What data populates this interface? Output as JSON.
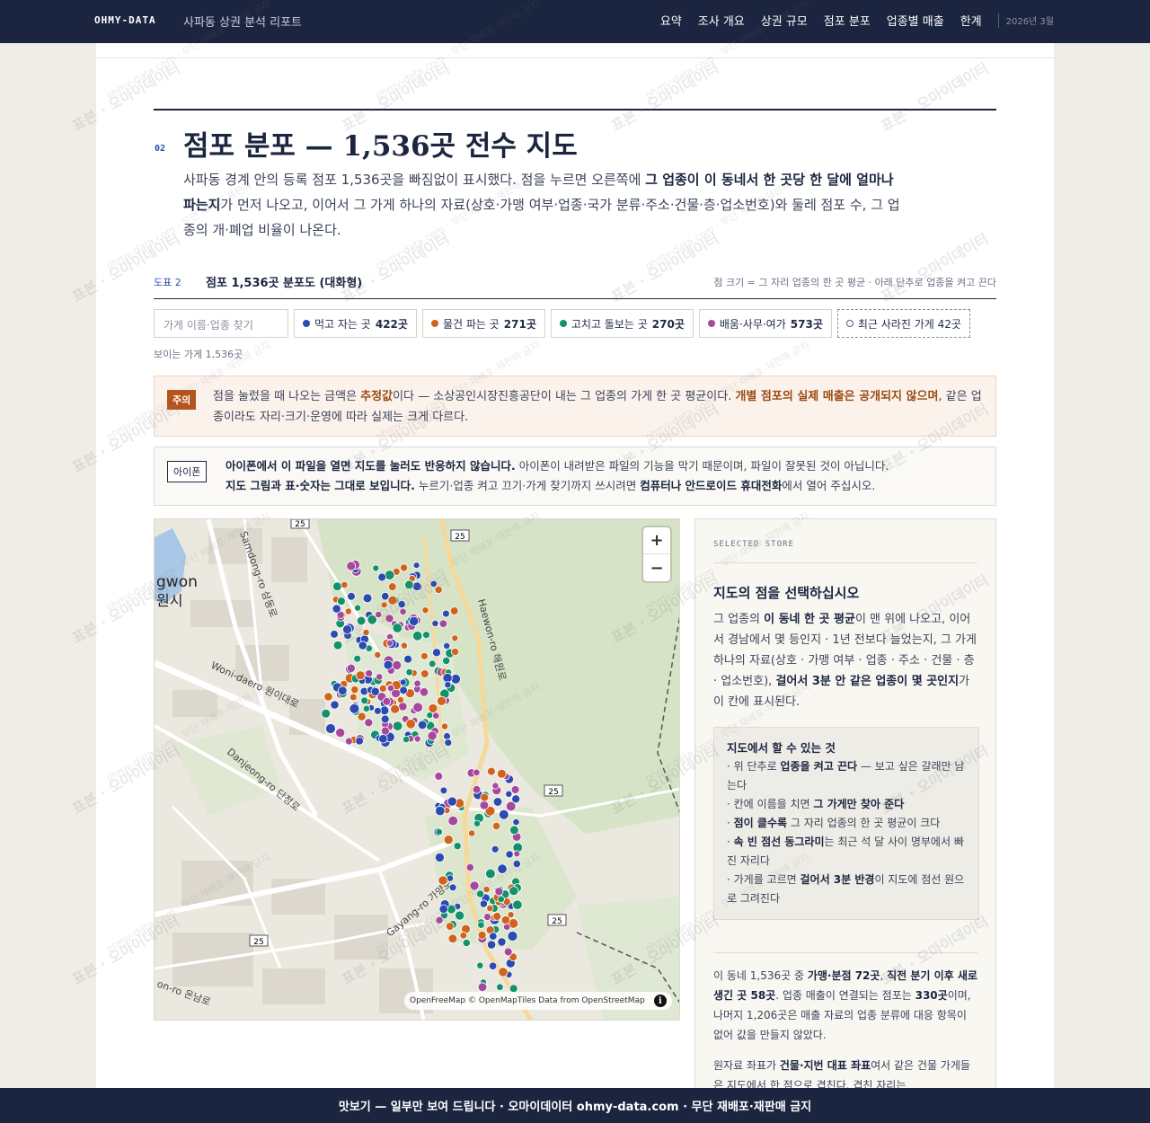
{
  "header": {
    "brand": "OHMY-DATA",
    "doc_title": "사파동 상권 분석 리포트",
    "nav": [
      "요약",
      "조사 개요",
      "상권 규모",
      "점포 분포",
      "업종별 매출",
      "한계"
    ],
    "date": "2026년 3월"
  },
  "section": {
    "number": "02",
    "title": "점포 분포 — 1,536곳 전수 지도",
    "lead_1": "사파동 경계 안의 등록 점포 1,536곳을 빠짐없이 표시했다. 점을 누르면 오른쪽에 ",
    "lead_bold": "그 업종이 이 동네서 한 곳당 한 달에 얼마나 파는지",
    "lead_2": "가 먼저 나오고, 이어서 그 가게 하나의 자료(상호·가맹 여부·업종·국가 분류·주소·건물·층·업소번호)와 둘레 점포 수, 그 업종의 개·폐업 비율이 나온다."
  },
  "figure": {
    "label": "도표 2",
    "title": "점포 1,536곳 분포도 (대화형)",
    "note": "점 크기 = 그 자리 업종의 한 곳 평균 · 아래 단추로 업종을 켜고 끈다"
  },
  "filters": {
    "search_placeholder": "가게 이름·업종 찾기",
    "chips": [
      {
        "label": "먹고 자는 곳",
        "count": "422곳",
        "color": "#2b4bb0"
      },
      {
        "label": "물건 파는 곳",
        "count": "271곳",
        "color": "#d0641c"
      },
      {
        "label": "고치고 돌보는 곳",
        "count": "270곳",
        "color": "#12916b"
      },
      {
        "label": "배움·사무·여가",
        "count": "573곳",
        "color": "#a6489c"
      }
    ],
    "closed_chip": "최근 사라진 가게 42곳",
    "visible_count": "보이는 가게 1,536곳"
  },
  "warning": {
    "tag": "주의",
    "t1": "점을 눌렀을 때 나오는 금액은 ",
    "b1": "추정값",
    "t2": "이다 — 소상공인시장진흥공단이 내는 그 업종의 가게 한 곳 평균이다. ",
    "b2": "개별 점포의 실제 매출은 공개되지 않으며",
    "t3": ", 같은 업종이라도 자리·크기·운영에 따라 실제는 크게 다르다."
  },
  "iphone": {
    "tag": "아이폰",
    "b1": "아이폰에서 이 파일을 열면 지도를 눌러도 반응하지 않습니다.",
    "t1": " 아이폰이 내려받은 파일의 기능을 막기 때문이며, 파일이 잘못된 것이 아닙니다.",
    "b2": "지도 그림과 표·숫자는 그대로 보입니다.",
    "t2": " 누르기·업종 켜고 끄기·가게 찾기까지 쓰시려면 ",
    "b3": "컴퓨터나 안드로이드 휴대전화",
    "t3": "에서 열어 주십시오."
  },
  "map": {
    "labels": {
      "city_en": "gwon",
      "city_ko": "원시",
      "road_haewon": "Haewon-ro 해원로",
      "road_wonidaero": "Woni-daero 원이대로",
      "road_danjeong": "Danjeong-ro 단정로",
      "road_gayang": "Gayang-ro 가양로",
      "road_sam": "Samdong-ro 삼동로",
      "road_on": "on-ro 온남로",
      "shield": "25"
    },
    "zoom_in": "+",
    "zoom_out": "−",
    "attribution": "OpenFreeMap © OpenMapTiles Data from OpenStreetMap",
    "info": "i"
  },
  "panel": {
    "kicker": "SELECTED STORE",
    "title": "지도의 점을 선택하십시오",
    "b1_a": "그 업종의 ",
    "b1_b": "이 동네 한 곳 평균",
    "b1_c": "이 맨 위에 나오고, 이어서 경남에서 몇 등인지 · 1년 전보다 늘었는지, 그 가게 하나의 자료(상호 · 가맹 여부 · 업종 · 주소 · 건물 · 층 · 업소번호), ",
    "b1_d": "걸어서 3분 안 같은 업종이 몇 곳인지",
    "b1_e": "가 이 칸에 표시된다.",
    "how_title": "지도에서 할 수 있는 것",
    "how_1a": "· 위 단추로 ",
    "how_1b": "업종을 켜고 끈다",
    "how_1c": " — 보고 싶은 갈래만 남는다",
    "how_2a": "· 칸에 이름을 치면 ",
    "how_2b": "그 가게만 찾아 준다",
    "how_3a": "· ",
    "how_3b": "점이 클수록",
    "how_3c": " 그 자리 업종의 한 곳 평균이 크다",
    "how_4a": "· ",
    "how_4b": "속 빈 점선 동그라미",
    "how_4c": "는 최근 석 달 사이 명부에서 빠진 자리다",
    "how_5a": "· 가게를 고르면 ",
    "how_5b": "걸어서 3분 반경",
    "how_5c": "이 지도에 점선 원으로 그려진다",
    "stats_a": "이 동네 1,536곳 중 ",
    "stats_b": "가맹·분점 72곳",
    "stats_c": ", ",
    "stats_d": "직전 분기 이후 새로 생긴 곳 58곳",
    "stats_e": ". 업종 매출이 연결되는 점포는 ",
    "stats_f": "330곳",
    "stats_g": "이며, 나머지 1,206곳은 매출 자료의 업종 분류에 대응 항목이 없어 값을 만들지 않았다.",
    "raw_a": "원자료 좌표가 ",
    "raw_b": "건물·지번 대표 좌표",
    "raw_c": "여서 같은 건물 가게들은 지도에서 한 점으로 겹친다. 겹친 자리는"
  },
  "watermark": {
    "main": "표본 · 오마이데이터",
    "small": "ohmy-data.com · 무단 재배포·재판매 금지"
  },
  "footer": "맛보기 — 일부만 보여 드립니다 · 오마이데이터 ohmy-data.com · 무단 재배포·재판매 금지",
  "colors": {
    "navy": "#1b2540",
    "eat": "#2b4bb0",
    "shop": "#d0641c",
    "care": "#12916b",
    "misc": "#a6489c"
  }
}
